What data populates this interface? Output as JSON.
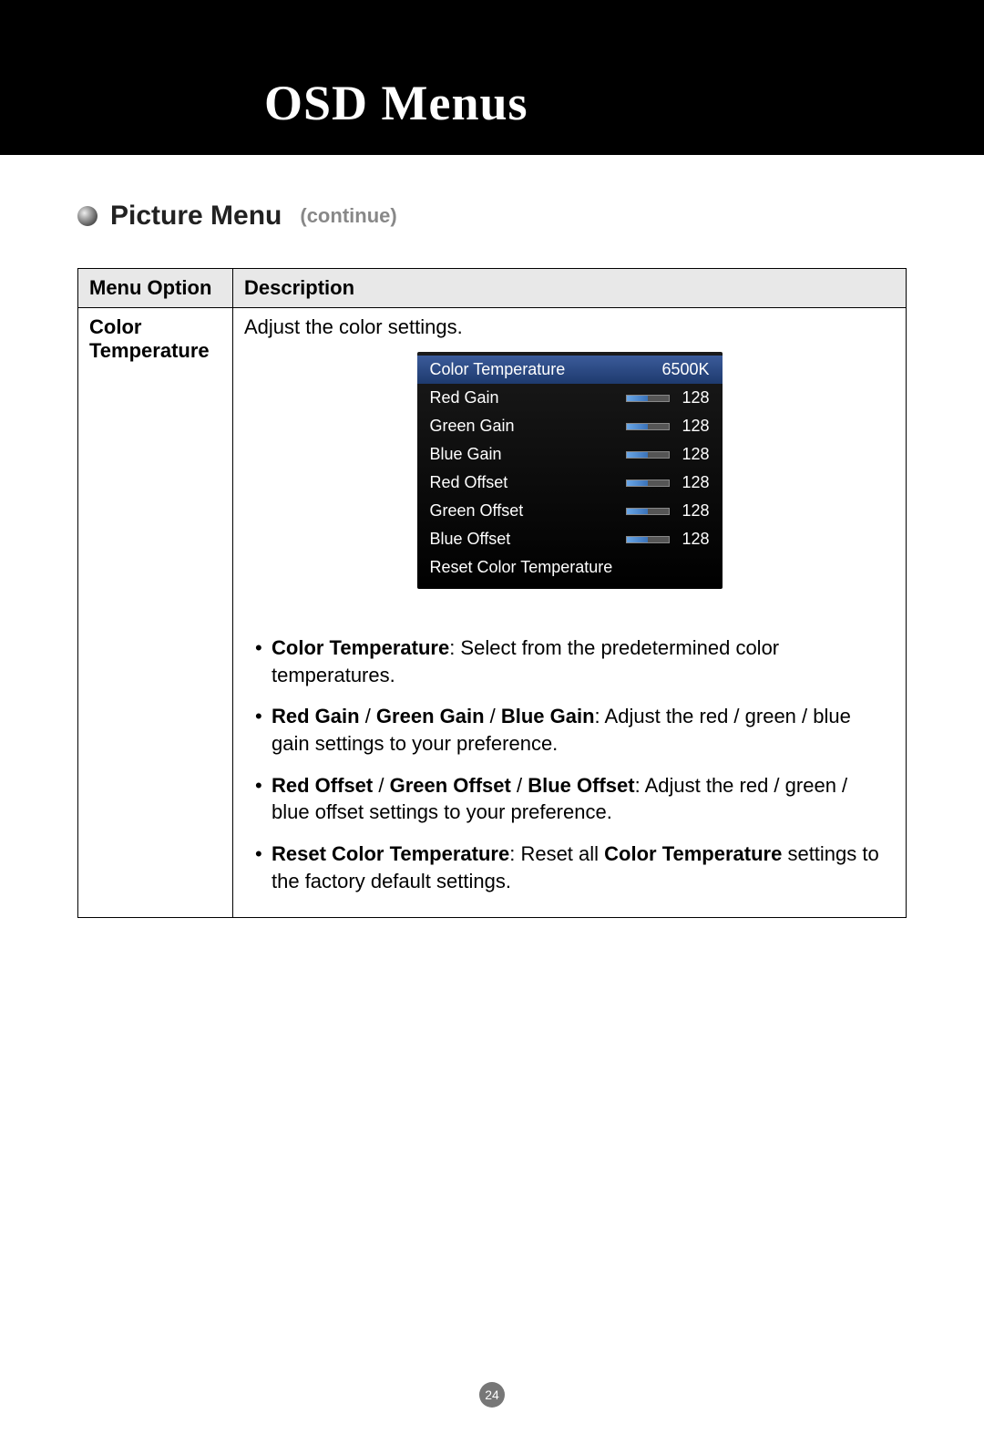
{
  "header": {
    "title": "OSD Menus"
  },
  "section": {
    "title": "Picture Menu",
    "sub": "(continue)"
  },
  "table": {
    "headers": {
      "option": "Menu Option",
      "desc": "Description"
    },
    "row": {
      "option": "Color Temperature",
      "desc_top": "Adjust the color settings."
    }
  },
  "osd": {
    "selected": {
      "label": "Color Temperature",
      "value": "6500K"
    },
    "rows": [
      {
        "label": "Red Gain",
        "value": "128"
      },
      {
        "label": "Green Gain",
        "value": "128"
      },
      {
        "label": "Blue Gain",
        "value": "128"
      },
      {
        "label": "Red Offset",
        "value": "128"
      },
      {
        "label": "Green Offset",
        "value": "128"
      },
      {
        "label": "Blue Offset",
        "value": "128"
      }
    ],
    "reset": "Reset Color Temperature"
  },
  "bullets": {
    "b1_bold": "Color Temperature",
    "b1_rest": ": Select from the predetermined color temperatures.",
    "b2_b1": "Red Gain",
    "b2_s1": " / ",
    "b2_b2": "Green Gain",
    "b2_s2": " / ",
    "b2_b3": "Blue Gain",
    "b2_rest": ": Adjust the red / green / blue gain settings to your preference.",
    "b3_b1": "Red Offset",
    "b3_s1": " / ",
    "b3_b2": "Green Offset",
    "b3_s2": " / ",
    "b3_b3": "Blue Offset",
    "b3_rest": ": Adjust the red / green / blue offset settings to your preference.",
    "b4_b1": "Reset Color Temperature",
    "b4_mid": ": Reset all ",
    "b4_b2": "Color Temperature",
    "b4_rest": " settings to the factory default settings."
  },
  "page": "24"
}
